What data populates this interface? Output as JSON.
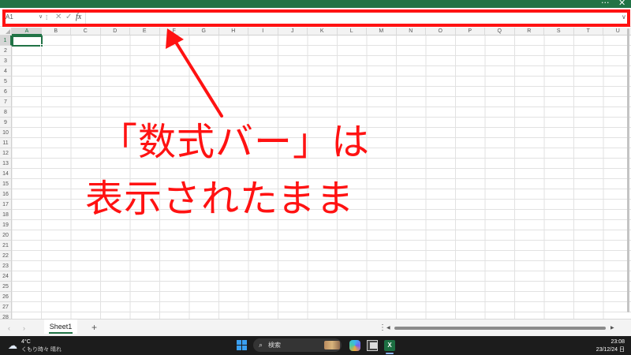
{
  "window": {
    "more_glyph": "···",
    "close_glyph": "✕",
    "accent": "#217346"
  },
  "formula_bar": {
    "name_box": "A1",
    "name_box_chevron": "∨",
    "separator_glyph": "⁞",
    "cancel_glyph": "✕",
    "enter_glyph": "✓",
    "fx_label": "fx",
    "formula_value": "",
    "expand_glyph": "∨"
  },
  "grid": {
    "columns": [
      "A",
      "B",
      "C",
      "D",
      "E",
      "F",
      "G",
      "H",
      "I",
      "J",
      "K",
      "L",
      "M",
      "N",
      "O",
      "P",
      "Q",
      "R",
      "S",
      "T",
      "U"
    ],
    "rows": [
      "1",
      "2",
      "3",
      "4",
      "5",
      "6",
      "7",
      "8",
      "9",
      "10",
      "11",
      "12",
      "13",
      "14",
      "15",
      "16",
      "17",
      "18",
      "19",
      "20",
      "21",
      "22",
      "23",
      "24",
      "25",
      "26",
      "27",
      "28"
    ],
    "active_cell": "A1"
  },
  "annotation": {
    "line1": "「数式バー」は",
    "line2": "表示されたまま",
    "color": "#ff1212"
  },
  "sheet_tabs": {
    "prev_glyph": "‹",
    "next_glyph": "›",
    "tabs": [
      {
        "label": "Sheet1",
        "active": true
      }
    ],
    "add_glyph": "+",
    "scroll_menu_glyph": "⋮",
    "scroll_left_glyph": "◀",
    "scroll_right_glyph": "▶"
  },
  "taskbar": {
    "weather_icon": "cloud-sun-icon",
    "weather_temp": "4°C",
    "weather_desc": "くもり時々 晴れ",
    "search_icon": "search-icon",
    "search_label": "検索",
    "excel_label": "X",
    "time": "23:08",
    "date": "23/12/24 日"
  }
}
